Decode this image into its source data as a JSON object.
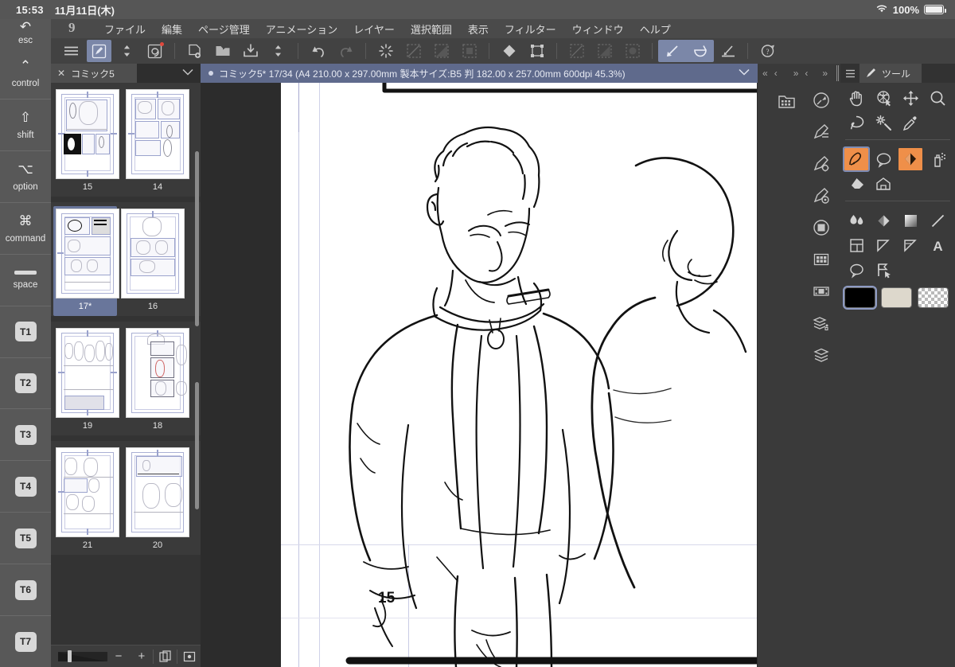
{
  "status_bar": {
    "time": "15:53",
    "date": "11月11日(木)",
    "battery_percent": "100%",
    "wifi_icon": "wifi-icon",
    "battery_icon": "battery-full-icon"
  },
  "left_rail": {
    "keys": [
      {
        "label": "esc",
        "glyph": "↶",
        "name": "esc"
      },
      {
        "label": "control",
        "glyph": "⌃",
        "name": "control"
      },
      {
        "label": "shift",
        "glyph": "⇧",
        "name": "shift"
      },
      {
        "label": "option",
        "glyph": "⌥",
        "name": "option"
      },
      {
        "label": "command",
        "glyph": "⌘",
        "name": "command"
      },
      {
        "label": "space",
        "glyph": "",
        "name": "space"
      },
      {
        "label": "",
        "glyph": "T1",
        "name": "t1"
      },
      {
        "label": "",
        "glyph": "T2",
        "name": "t2"
      },
      {
        "label": "",
        "glyph": "T3",
        "name": "t3"
      },
      {
        "label": "",
        "glyph": "T4",
        "name": "t4"
      },
      {
        "label": "",
        "glyph": "T5",
        "name": "t5"
      },
      {
        "label": "",
        "glyph": "T6",
        "name": "t6"
      },
      {
        "label": "",
        "glyph": "T7",
        "name": "t7"
      }
    ]
  },
  "menu_bar": {
    "app_logo": "clip-studio-paint-logo",
    "items": [
      "ファイル",
      "編集",
      "ページ管理",
      "アニメーション",
      "レイヤー",
      "選択範囲",
      "表示",
      "フィルター",
      "ウィンドウ",
      "ヘルプ"
    ]
  },
  "command_bar": {
    "buttons": [
      {
        "name": "hamburger-menu-icon",
        "selected": false,
        "disabled": false
      },
      {
        "name": "brush-settings-icon",
        "selected": true,
        "disabled": false
      },
      {
        "name": "chevron-updown-icon",
        "selected": false,
        "disabled": false
      },
      {
        "name": "swirl-material-icon",
        "selected": false,
        "disabled": false
      },
      {
        "name": "new-page-icon",
        "selected": false,
        "disabled": false
      },
      {
        "name": "open-folder-icon",
        "selected": false,
        "disabled": false
      },
      {
        "name": "save-icon",
        "selected": false,
        "disabled": false
      },
      {
        "name": "chevron-updown-save-icon",
        "selected": false,
        "disabled": false
      },
      {
        "name": "undo-icon",
        "selected": false,
        "disabled": false
      },
      {
        "name": "redo-icon",
        "selected": false,
        "disabled": true
      },
      {
        "name": "deselect-icon",
        "selected": false,
        "disabled": false
      },
      {
        "name": "select-all-icon",
        "selected": false,
        "disabled": true
      },
      {
        "name": "invert-selection-icon",
        "selected": false,
        "disabled": true
      },
      {
        "name": "fill-selection-icon",
        "selected": false,
        "disabled": true
      },
      {
        "name": "fill-icon",
        "selected": false,
        "disabled": false
      },
      {
        "name": "transform-icon",
        "selected": false,
        "disabled": false
      },
      {
        "name": "ruler-snap-off-icon",
        "selected": false,
        "disabled": true
      },
      {
        "name": "ruler-snap-grid-icon",
        "selected": false,
        "disabled": true
      },
      {
        "name": "ruler-snap-special-icon",
        "selected": false,
        "disabled": true
      },
      {
        "name": "snap-to-ruler-icon",
        "selected": true,
        "disabled": false
      },
      {
        "name": "snap-to-curve-icon",
        "selected": true,
        "disabled": false
      },
      {
        "name": "snap-to-guide-icon",
        "selected": false,
        "disabled": false
      },
      {
        "name": "help-icon",
        "selected": false,
        "disabled": false
      }
    ]
  },
  "page_panel": {
    "tab_label": "コミック5",
    "close_icon": "close-icon",
    "chevron_icon": "chevron-down-icon",
    "rows": [
      {
        "pages": [
          {
            "label": "15",
            "active": false,
            "art": "p15"
          },
          {
            "label": "14",
            "active": false,
            "art": "p14"
          }
        ]
      },
      {
        "pages": [
          {
            "label": "17*",
            "active": true,
            "art": "p17"
          },
          {
            "label": "16",
            "active": false,
            "art": "p16"
          }
        ]
      },
      {
        "pages": [
          {
            "label": "19",
            "active": false,
            "art": "p19"
          },
          {
            "label": "18",
            "active": false,
            "art": "p18"
          }
        ]
      },
      {
        "pages": [
          {
            "label": "21",
            "active": false,
            "art": "p21"
          },
          {
            "label": "20",
            "active": false,
            "art": "p20"
          }
        ]
      }
    ],
    "footer": {
      "zoom_slider_name": "thumbnail-size-slider",
      "minus_label": "−",
      "plus_label": "+",
      "buttons": [
        "duplicate-page-icon",
        "page-settings-icon"
      ]
    }
  },
  "canvas": {
    "document_title": "コミック5* 17/34 (A4 210.00 x 297.00mm 製本サイズ:B5 判 182.00 x 257.00mm 600dpi 45.3%)",
    "modified_dot": "unsaved-indicator",
    "chevron_icon": "chevron-down-icon",
    "page_number_stamp": "15",
    "zoom_percent": "45.3%",
    "page_index": "17/34",
    "paper_size": "A4 210.00 x 297.00mm",
    "binding_size": "B5 判 182.00 x 257.00mm",
    "resolution": "600dpi"
  },
  "right_icon_rail": {
    "header_icons": [
      "collapse-all-icon",
      "collapse-icon",
      "expand-all-icon",
      "expand-icon",
      "grip-icon"
    ],
    "left_column": [
      {
        "name": "material-palette-icon"
      }
    ],
    "right_column": [
      {
        "name": "navigator-icon"
      },
      {
        "name": "subtool-detail-icon"
      },
      {
        "name": "tool-property-icon"
      },
      {
        "name": "brush-size-icon"
      },
      {
        "name": "color-circle-icon"
      },
      {
        "name": "color-set-icon"
      },
      {
        "name": "timeline-icon"
      },
      {
        "name": "layer-property-icon"
      },
      {
        "name": "layer-icon"
      }
    ]
  },
  "tool_palette": {
    "hamburger_icon": "hamburger-menu-icon",
    "tab_icon": "pen-icon",
    "tab_label": "ツール",
    "tools": [
      {
        "name": "hand-tool-icon",
        "selected": false,
        "highlight": false
      },
      {
        "name": "rotate-tool-icon",
        "selected": false,
        "highlight": false
      },
      {
        "name": "move-tool-icon",
        "selected": false,
        "highlight": false
      },
      {
        "name": "zoom-tool-icon",
        "selected": false,
        "highlight": false
      },
      {
        "name": "lasso-select-tool-icon",
        "selected": false,
        "highlight": false
      },
      {
        "name": "magic-wand-tool-icon",
        "selected": false,
        "highlight": false
      },
      {
        "name": "eyedropper-tool-icon",
        "selected": false,
        "highlight": false
      },
      {
        "name": "pen-tool-icon",
        "selected": true,
        "highlight": true
      },
      {
        "name": "balloon-tool-icon",
        "selected": false,
        "highlight": false
      },
      {
        "name": "marker-tool-icon",
        "selected": false,
        "highlight": true
      },
      {
        "name": "airbrush-tool-icon",
        "selected": false,
        "highlight": false
      },
      {
        "name": "eraser-tool-icon",
        "selected": false,
        "highlight": false
      },
      {
        "name": "decoration-tool-icon",
        "selected": false,
        "highlight": false
      },
      {
        "name": "blend-tool-icon",
        "selected": false,
        "highlight": false
      },
      {
        "name": "fill-tool-icon",
        "selected": false,
        "highlight": false
      },
      {
        "name": "gradient-tool-icon",
        "selected": false,
        "highlight": false
      },
      {
        "name": "figure-tool-icon",
        "selected": false,
        "highlight": false
      },
      {
        "name": "frame-border-tool-icon",
        "selected": false,
        "highlight": false
      },
      {
        "name": "ruler-tool-icon",
        "selected": false,
        "highlight": false
      },
      {
        "name": "perspective-ruler-tool-icon",
        "selected": false,
        "highlight": false
      },
      {
        "name": "text-tool-icon",
        "selected": false,
        "highlight": false
      },
      {
        "name": "balloon-tail-tool-icon",
        "selected": false,
        "highlight": false
      },
      {
        "name": "operation-tool-icon",
        "selected": false,
        "highlight": false
      }
    ],
    "swatches": [
      {
        "name": "main-color-swatch",
        "color": "#000000",
        "selected": true
      },
      {
        "name": "sub-color-swatch",
        "color": "#ddd8cc",
        "selected": false
      },
      {
        "name": "transparent-color-swatch",
        "color": "transparent",
        "selected": false
      }
    ],
    "accent_color": "#ef8f49",
    "selection_color": "#7b87a8"
  }
}
